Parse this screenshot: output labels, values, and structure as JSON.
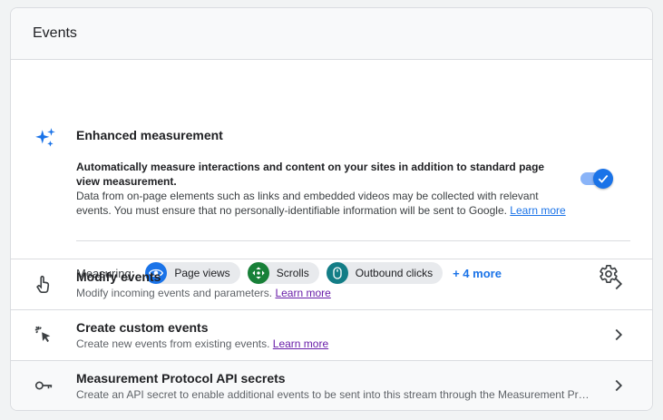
{
  "card": {
    "title": "Events"
  },
  "enhanced": {
    "title": "Enhanced measurement",
    "desc_bold": "Automatically measure interactions and content on your sites in addition to standard page view measurement.",
    "desc_text": "Data from on-page elements such as links and embedded videos may be collected with relevant events. You must ensure that no personally-identifiable information will be sent to Google.",
    "learn_more": "Learn more",
    "toggle_on": true,
    "measuring_label": "Measuring:",
    "chips": [
      {
        "label": "Page views",
        "icon": "eye-icon",
        "color": "#1a73e8"
      },
      {
        "label": "Scrolls",
        "icon": "scroll-arrows-icon",
        "color": "#188038"
      },
      {
        "label": "Outbound clicks",
        "icon": "mouse-icon",
        "color": "#137d86"
      }
    ],
    "more": "+ 4 more",
    "settings_icon": "gear-icon"
  },
  "rows": [
    {
      "title": "Modify events",
      "desc": "Modify incoming events and parameters.",
      "link": "Learn more",
      "icon": "touch-icon"
    },
    {
      "title": "Create custom events",
      "desc": "Create new events from existing events.",
      "link": "Learn more",
      "icon": "cursor-click-icon"
    },
    {
      "title": "Measurement Protocol API secrets",
      "desc": "Create an API secret to enable additional events to be sent into this stream through the Measurement Protocol.",
      "icon": "key-icon"
    }
  ],
  "colors": {
    "accent": "#1a73e8",
    "link_visited": "#681da8",
    "border": "#dadce0"
  }
}
